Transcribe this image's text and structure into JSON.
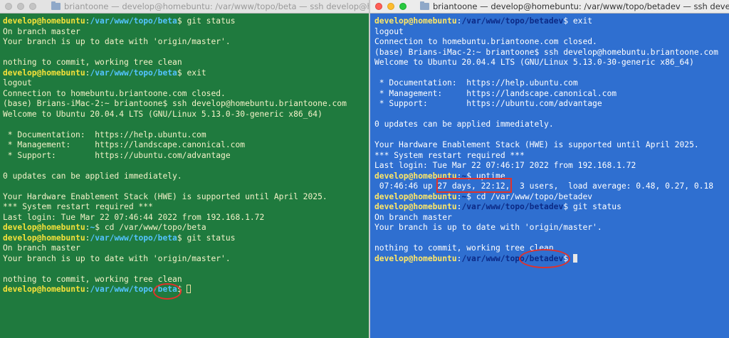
{
  "left_window": {
    "title": "briantoone — develop@homebuntu: /var/www/topo/beta — ssh develop@homebu",
    "lines": [
      [
        {
          "t": "develop@homebuntu",
          "c": "user"
        },
        {
          "t": ":",
          "c": "txt"
        },
        {
          "t": "/var/www/topo/beta",
          "c": "path"
        },
        {
          "t": "$ git status",
          "c": "txt"
        }
      ],
      [
        {
          "t": "On branch master",
          "c": "txt"
        }
      ],
      [
        {
          "t": "Your branch is up to date with 'origin/master'.",
          "c": "txt"
        }
      ],
      [
        {
          "t": "",
          "c": "txt"
        }
      ],
      [
        {
          "t": "nothing to commit, working tree clean",
          "c": "txt"
        }
      ],
      [
        {
          "t": "develop@homebuntu",
          "c": "user"
        },
        {
          "t": ":",
          "c": "txt"
        },
        {
          "t": "/var/www/topo/beta",
          "c": "path"
        },
        {
          "t": "$ exit",
          "c": "txt"
        }
      ],
      [
        {
          "t": "logout",
          "c": "txt"
        }
      ],
      [
        {
          "t": "Connection to homebuntu.briantoone.com closed.",
          "c": "txt"
        }
      ],
      [
        {
          "t": "(base) Brians-iMac-2:~ briantoone$ ssh develop@homebuntu.briantoone.com",
          "c": "txt"
        }
      ],
      [
        {
          "t": "Welcome to Ubuntu 20.04.4 LTS (GNU/Linux 5.13.0-30-generic x86_64)",
          "c": "txt"
        }
      ],
      [
        {
          "t": "",
          "c": "txt"
        }
      ],
      [
        {
          "t": " * Documentation:  https://help.ubuntu.com",
          "c": "txt"
        }
      ],
      [
        {
          "t": " * Management:     https://landscape.canonical.com",
          "c": "txt"
        }
      ],
      [
        {
          "t": " * Support:        https://ubuntu.com/advantage",
          "c": "txt"
        }
      ],
      [
        {
          "t": "",
          "c": "txt"
        }
      ],
      [
        {
          "t": "0 updates can be applied immediately.",
          "c": "txt"
        }
      ],
      [
        {
          "t": "",
          "c": "txt"
        }
      ],
      [
        {
          "t": "Your Hardware Enablement Stack (HWE) is supported until April 2025.",
          "c": "txt"
        }
      ],
      [
        {
          "t": "*** System restart required ***",
          "c": "txt"
        }
      ],
      [
        {
          "t": "Last login: Tue Mar 22 07:46:44 2022 from 192.168.1.72",
          "c": "txt"
        }
      ],
      [
        {
          "t": "develop@homebuntu",
          "c": "user"
        },
        {
          "t": ":",
          "c": "txt"
        },
        {
          "t": "~",
          "c": "path"
        },
        {
          "t": "$ cd /var/www/topo/beta",
          "c": "txt"
        }
      ],
      [
        {
          "t": "develop@homebuntu",
          "c": "user"
        },
        {
          "t": ":",
          "c": "txt"
        },
        {
          "t": "/var/www/topo/beta",
          "c": "path"
        },
        {
          "t": "$ git status",
          "c": "txt"
        }
      ],
      [
        {
          "t": "On branch master",
          "c": "txt"
        }
      ],
      [
        {
          "t": "Your branch is up to date with 'origin/master'.",
          "c": "txt"
        }
      ],
      [
        {
          "t": "",
          "c": "txt"
        }
      ],
      [
        {
          "t": "nothing to commit, working tree clean",
          "c": "txt"
        }
      ],
      [
        {
          "t": "develop@homebuntu",
          "c": "user"
        },
        {
          "t": ":",
          "c": "txt"
        },
        {
          "t": "/var/www/topo/beta",
          "c": "path"
        },
        {
          "t": "$ ",
          "c": "txt"
        },
        {
          "t": "",
          "c": "cursor"
        }
      ]
    ]
  },
  "right_window": {
    "title": "briantoone — develop@homebuntu: /var/www/topo/betadev — ssh develop@",
    "lines": [
      [
        {
          "t": "develop@homebuntu",
          "c": "user"
        },
        {
          "t": ":",
          "c": "txt"
        },
        {
          "t": "/var/www/topo/betadev",
          "c": "path"
        },
        {
          "t": "$ exit",
          "c": "txt"
        }
      ],
      [
        {
          "t": "logout",
          "c": "txt"
        }
      ],
      [
        {
          "t": "Connection to homebuntu.briantoone.com closed.",
          "c": "txt"
        }
      ],
      [
        {
          "t": "(base) Brians-iMac-2:~ briantoone$ ssh develop@homebuntu.briantoone.com",
          "c": "txt"
        }
      ],
      [
        {
          "t": "Welcome to Ubuntu 20.04.4 LTS (GNU/Linux 5.13.0-30-generic x86_64)",
          "c": "txt"
        }
      ],
      [
        {
          "t": "",
          "c": "txt"
        }
      ],
      [
        {
          "t": " * Documentation:  https://help.ubuntu.com",
          "c": "txt"
        }
      ],
      [
        {
          "t": " * Management:     https://landscape.canonical.com",
          "c": "txt"
        }
      ],
      [
        {
          "t": " * Support:        https://ubuntu.com/advantage",
          "c": "txt"
        }
      ],
      [
        {
          "t": "",
          "c": "txt"
        }
      ],
      [
        {
          "t": "0 updates can be applied immediately.",
          "c": "txt"
        }
      ],
      [
        {
          "t": "",
          "c": "txt"
        }
      ],
      [
        {
          "t": "Your Hardware Enablement Stack (HWE) is supported until April 2025.",
          "c": "txt"
        }
      ],
      [
        {
          "t": "*** System restart required ***",
          "c": "txt"
        }
      ],
      [
        {
          "t": "Last login: Tue Mar 22 07:46:17 2022 from 192.168.1.72",
          "c": "txt"
        }
      ],
      [
        {
          "t": "develop@homebuntu",
          "c": "user"
        },
        {
          "t": ":",
          "c": "txt"
        },
        {
          "t": "~",
          "c": "path"
        },
        {
          "t": "$ uptime",
          "c": "txt"
        }
      ],
      [
        {
          "t": " 07:46:46 up 27 days, 22:12,  3 users,  load average: 0.48, 0.27, 0.18",
          "c": "txt"
        }
      ],
      [
        {
          "t": "develop@homebuntu",
          "c": "user"
        },
        {
          "t": ":",
          "c": "txt"
        },
        {
          "t": "~",
          "c": "path"
        },
        {
          "t": "$ cd /var/www/topo/betadev",
          "c": "txt"
        }
      ],
      [
        {
          "t": "develop@homebuntu",
          "c": "user"
        },
        {
          "t": ":",
          "c": "txt"
        },
        {
          "t": "/var/www/topo/betadev",
          "c": "path"
        },
        {
          "t": "$ git status",
          "c": "txt"
        }
      ],
      [
        {
          "t": "On branch master",
          "c": "txt"
        }
      ],
      [
        {
          "t": "Your branch is up to date with 'origin/master'.",
          "c": "txt"
        }
      ],
      [
        {
          "t": "",
          "c": "txt"
        }
      ],
      [
        {
          "t": "nothing to commit, working tree clean",
          "c": "txt"
        }
      ],
      [
        {
          "t": "develop@homebuntu",
          "c": "user"
        },
        {
          "t": ":",
          "c": "txt"
        },
        {
          "t": "/var/www/topo/betadev",
          "c": "path"
        },
        {
          "t": "$ ",
          "c": "txt"
        },
        {
          "t": "",
          "c": "cursor"
        }
      ]
    ]
  },
  "annotation_color": "#e0322b"
}
